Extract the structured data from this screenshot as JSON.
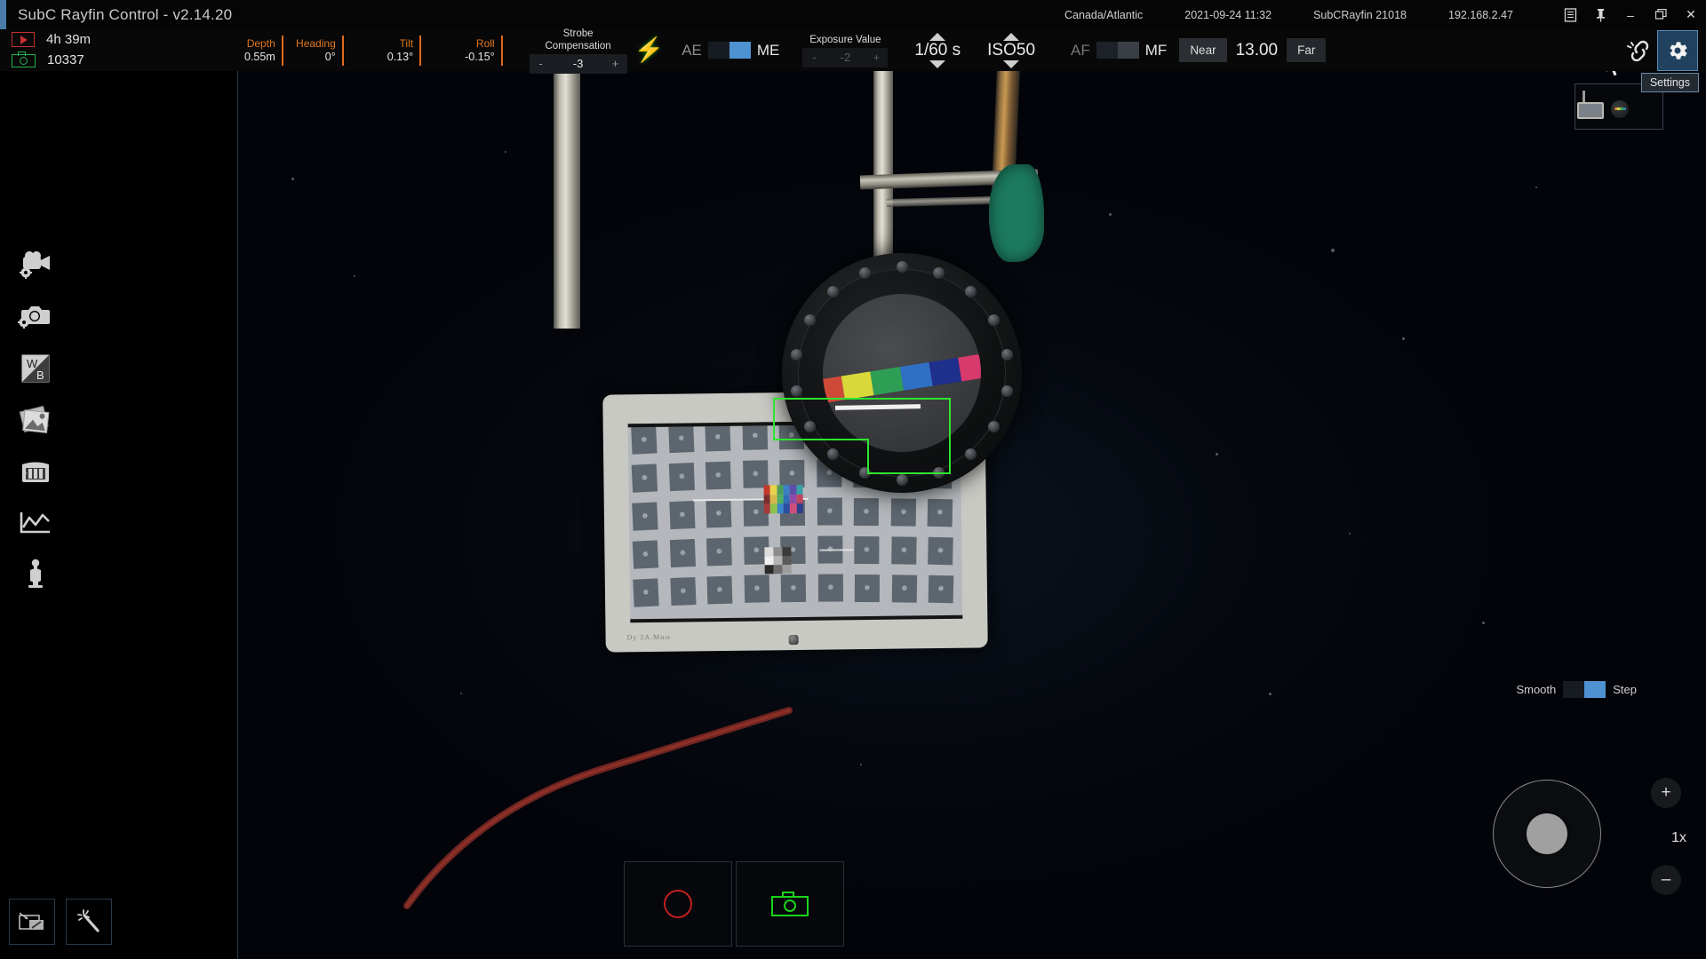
{
  "titlebar": {
    "app_title": "SubC Rayfin Control - v2.14.20",
    "timezone": "Canada/Atlantic",
    "datetime": "2021-09-24 11:32",
    "device_name": "SubCRayfin 21018",
    "ip_address": "192.168.2.47",
    "buttons": {
      "log": "log-icon",
      "pin": "pin-icon",
      "minimize": "–",
      "restore": "❐",
      "close": "✕"
    }
  },
  "controlbar": {
    "recording_time": "4h 39m",
    "image_count": "10337",
    "telemetry": [
      {
        "label": "Depth",
        "value": "0.55m"
      },
      {
        "label": "Heading",
        "value": "0°"
      },
      {
        "label": "Tilt",
        "value": "0.13°"
      },
      {
        "label": "Roll",
        "value": "-0.15°"
      }
    ],
    "strobe": {
      "label": "Strobe Compensation",
      "minus": "-",
      "value": "-3",
      "plus": "+"
    },
    "strobe_icon": "lightning-bolt-icon",
    "exposure_mode": {
      "auto": "AE",
      "manual": "ME",
      "selected": "ME"
    },
    "exposure_value": {
      "label": "Exposure Value",
      "minus": "-",
      "value": "-2",
      "plus": "+"
    },
    "shutter_speed": "1/60 s",
    "iso": "ISO50",
    "focus_mode": {
      "auto": "AF",
      "manual": "MF",
      "selected": "MF"
    },
    "focus_near": "Near",
    "focus_distance": "13.00",
    "focus_far": "Far",
    "link_icon": "link-broken-icon",
    "settings_icon": "gear-icon"
  },
  "sidebar": {
    "items": [
      {
        "name": "video-settings",
        "icon": "video-camera-gear-icon"
      },
      {
        "name": "camera-settings",
        "icon": "photo-camera-gear-icon"
      },
      {
        "name": "white-balance",
        "icon": "white-balance-icon"
      },
      {
        "name": "gallery",
        "icon": "photos-stack-icon"
      },
      {
        "name": "storage",
        "icon": "storage-drive-icon"
      },
      {
        "name": "telemetry-graph",
        "icon": "line-chart-icon"
      },
      {
        "name": "lamp",
        "icon": "lantern-icon"
      }
    ],
    "bottom": [
      {
        "name": "overlay-tool",
        "icon": "annotation-overlay-icon"
      },
      {
        "name": "auto-enhance",
        "icon": "magic-wand-icon"
      }
    ]
  },
  "video": {
    "tooltip": "Settings",
    "cursor": "mouse-pointer-icon",
    "pip_label": "picture-in-picture-preview",
    "focus_box_color": "#2ee62e",
    "zoom": {
      "smooth_label": "Smooth",
      "step_label": "Step",
      "selected_mode": "Step",
      "zoom_in": "+",
      "zoom_level": "1x",
      "zoom_out": "–"
    },
    "capture": {
      "record_button": "record-button",
      "snapshot_button": "snapshot-button"
    },
    "scene": {
      "description": "Underwater calibration target board and circular bolted camera housing",
      "board_handwriting": "Dy  2A.Mαω",
      "color_checker": [
        "#c0392b",
        "#e8d24a",
        "#4d9e5a",
        "#3c7fc4",
        "#5b4fa8",
        "#3a9ea8",
        "#7a2f2f",
        "#d6b84c",
        "#4fae63",
        "#2f6fb5",
        "#8e4aa8",
        "#c0455f",
        "#a63939",
        "#8ec24a",
        "#3a86c9",
        "#2a4fa0",
        "#d04f7a",
        "#2f3f8c"
      ],
      "gray_checker": [
        "#dcdcdc",
        "#8c8c8c",
        "#3a3a3a",
        "#f0f0f0",
        "#b4b4b4",
        "#5a5a5a",
        "#2a2a2a",
        "#6e6e6e",
        "#9e9e9e"
      ],
      "porthole_strip": [
        "#d04a3a",
        "#d8d83a",
        "#2f9e55",
        "#2f6fc4",
        "#1f2f8c",
        "#d83a6e"
      ]
    }
  },
  "colors": {
    "accent": "#4e92d2",
    "telemetry_label": "#e0761f",
    "record_red": "#c02020",
    "capture_green": "#19d419",
    "strobe_green": "#19e019",
    "title_accent": "#4a7ba8"
  }
}
